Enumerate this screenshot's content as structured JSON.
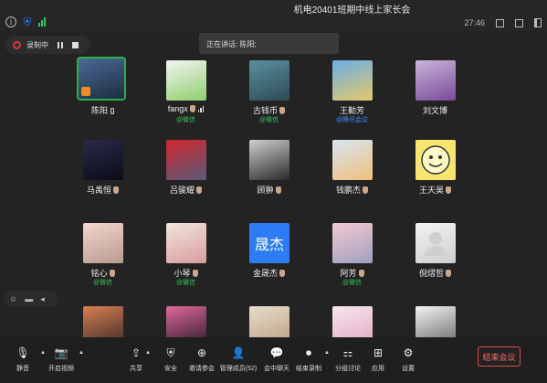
{
  "window": {
    "title": "机电20401班期中线上家长会",
    "timer": "27:46"
  },
  "recording": {
    "label": "录制中"
  },
  "speaking": {
    "text": "正在讲话: 陈阳;"
  },
  "participants": [
    {
      "name": "陈阳",
      "sub": "",
      "avatar": "photo-dusk",
      "colors": [
        "#4a6a96",
        "#1e2d3f"
      ],
      "active": true,
      "mic": true
    },
    {
      "name": "fangx",
      "sub": "@微信",
      "avatar": "cartoon-frogs",
      "colors": [
        "#f4f4f4",
        "#8fcf6c"
      ],
      "hand": true,
      "bars": true
    },
    {
      "name": "古钱币",
      "sub": "@微信",
      "avatar": "photo-road",
      "colors": [
        "#5b8fa0",
        "#2d4b55"
      ],
      "hand": true
    },
    {
      "name": "王勤芳",
      "sub": "@腾讯会议",
      "subBlue": true,
      "avatar": "photo-sky",
      "colors": [
        "#69aee8",
        "#e6c96a"
      ]
    },
    {
      "name": "刘文博",
      "sub": "",
      "avatar": "anime-girl",
      "colors": [
        "#c9b6d8",
        "#7a4a9a"
      ]
    },
    {
      "name": "马禹恒",
      "sub": "",
      "avatar": "anime-dark",
      "colors": [
        "#2a2a4a",
        "#0b0b18"
      ],
      "hand": true
    },
    {
      "name": "吕骏耀",
      "sub": "",
      "avatar": "photo-flag",
      "colors": [
        "#d1272e",
        "#5a5a7a"
      ],
      "hand": true
    },
    {
      "name": "顾翀",
      "sub": "",
      "avatar": "cartoon-cat",
      "colors": [
        "#cfcfcf",
        "#2a2a2a"
      ],
      "hand": true
    },
    {
      "name": "钱鹏杰",
      "sub": "",
      "avatar": "cartoon-boy",
      "colors": [
        "#d6e6f2",
        "#f0c07a"
      ],
      "hand": true
    },
    {
      "name": "王天昊",
      "sub": "",
      "avatar": "smiley-face",
      "colors": [
        "#f5e26a",
        "#e9c830"
      ],
      "hand": true
    },
    {
      "name": "铭心",
      "sub": "@微信",
      "avatar": "photo-baby",
      "colors": [
        "#f2d6cf",
        "#b99a8f"
      ],
      "hand": true
    },
    {
      "name": "小琴",
      "sub": "@微信",
      "avatar": "anime-princess",
      "colors": [
        "#f1e6dd",
        "#d89c9c"
      ],
      "hand": true
    },
    {
      "name": "金晟杰",
      "sub": "",
      "avatar": "text-sheng-jie",
      "avatarText": "晟杰",
      "colors": [
        "#2d7cf6",
        "#2d7cf6"
      ],
      "hand": true
    },
    {
      "name": "阿芳",
      "sub": "@微信",
      "avatar": "photo-girl",
      "colors": [
        "#f3c9d0",
        "#a0a0c0"
      ],
      "hand": true
    },
    {
      "name": "倪熠哲",
      "sub": "",
      "avatar": "default-user",
      "colors": [
        "#f2f2f2",
        "#cfcfcf"
      ],
      "hand": true
    },
    {
      "name": "",
      "sub": "",
      "avatar": "photo-orange",
      "colors": [
        "#d98050",
        "#3a2a2a"
      ]
    },
    {
      "name": "",
      "sub": "",
      "avatar": "photo-flowers",
      "colors": [
        "#e06a9a",
        "#2a1a2a"
      ]
    },
    {
      "name": "",
      "sub": "",
      "avatar": "anime-boy",
      "colors": [
        "#e8dccc",
        "#b9a080"
      ]
    },
    {
      "name": "",
      "sub": "",
      "avatar": "photo-blossom",
      "colors": [
        "#f6e6ee",
        "#e0a8c0"
      ]
    },
    {
      "name": "",
      "sub": "",
      "avatar": "photo-man",
      "colors": [
        "#f4f4f4",
        "#666"
      ]
    }
  ],
  "toolbar": [
    {
      "label": "静音",
      "icon": "mic-icon",
      "glyph": "🎙"
    },
    {
      "label": "开启视频",
      "icon": "video-off-icon",
      "glyph": "📷"
    },
    {
      "label": "共享",
      "icon": "share-screen-icon",
      "glyph": "⇪"
    },
    {
      "label": "安全",
      "icon": "shield-icon",
      "glyph": "⛨"
    },
    {
      "label": "邀请参会",
      "icon": "invite-icon",
      "glyph": "⊕"
    },
    {
      "label": "管理成员(52)",
      "icon": "members-icon",
      "glyph": "👤"
    },
    {
      "label": "会中聊天",
      "icon": "chat-icon",
      "glyph": "💬"
    },
    {
      "label": "结束录制",
      "icon": "stop-record-icon",
      "glyph": "⏺"
    },
    {
      "label": "分组讨论",
      "icon": "breakout-icon",
      "glyph": "⚏"
    },
    {
      "label": "应用",
      "icon": "apps-icon",
      "glyph": "⊞"
    },
    {
      "label": "设置",
      "icon": "settings-icon",
      "glyph": "⚙"
    }
  ],
  "end_button": "结束会议",
  "colors": {
    "accent_green": "#2bb04a",
    "end_red": "#e04848",
    "brand_blue": "#2d7cf6"
  }
}
